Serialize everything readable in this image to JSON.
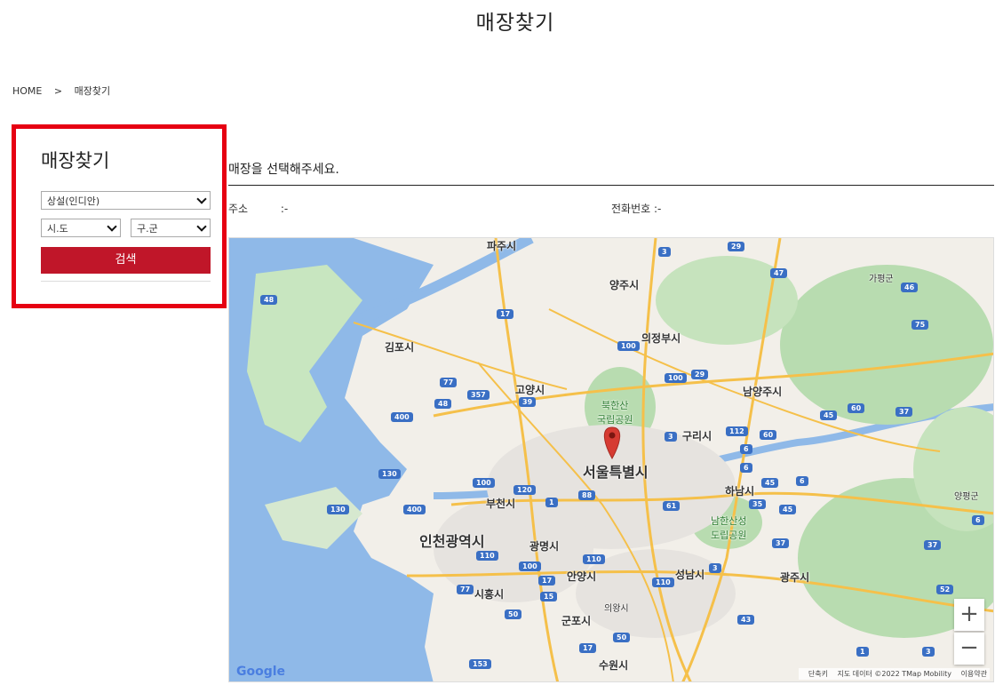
{
  "page": {
    "title": "매장찾기"
  },
  "breadcrumb": {
    "home": "HOME",
    "sep": ">",
    "current": "매장찾기"
  },
  "search": {
    "title": "매장찾기",
    "brand_select": "상설(인디안)",
    "sido_select": "시.도",
    "gugun_select": "구.군",
    "button": "검색"
  },
  "info": {
    "heading": "매장을 선택해주세요.",
    "address_label": "주소",
    "address_value": ":-",
    "phone_label": "전화번호",
    "phone_value": ":-"
  },
  "map": {
    "cities": [
      {
        "name": "파주시"
      },
      {
        "name": "양주시"
      },
      {
        "name": "의정부시"
      },
      {
        "name": "김포시"
      },
      {
        "name": "고양시"
      },
      {
        "name": "남양주시"
      },
      {
        "name": "구리시"
      },
      {
        "name": "서울특별시"
      },
      {
        "name": "하남시"
      },
      {
        "name": "부천시"
      },
      {
        "name": "인천광역시"
      },
      {
        "name": "광명시"
      },
      {
        "name": "안양시"
      },
      {
        "name": "시흥시"
      },
      {
        "name": "성남시"
      },
      {
        "name": "광주시"
      },
      {
        "name": "군포시"
      },
      {
        "name": "의왕시"
      },
      {
        "name": "수원시"
      },
      {
        "name": "가평군"
      },
      {
        "name": "양평군"
      },
      {
        "name": "북한산\n국립공원"
      },
      {
        "name": "남한산성\n도립공원"
      }
    ],
    "shields": [
      "29",
      "47",
      "46",
      "17",
      "3",
      "100",
      "75",
      "48",
      "77",
      "357",
      "39",
      "100",
      "29",
      "60",
      "37",
      "400",
      "48",
      "6",
      "3",
      "112",
      "60",
      "45",
      "130",
      "100",
      "120",
      "1",
      "88",
      "61",
      "6",
      "35",
      "45",
      "45",
      "6",
      "130",
      "400",
      "110",
      "37",
      "100",
      "17",
      "15",
      "110",
      "3",
      "37",
      "52",
      "110",
      "77",
      "50",
      "17",
      "43",
      "50",
      "3",
      "153",
      "1",
      "6"
    ],
    "zoom_in": "+",
    "zoom_out": "−",
    "google": "Google",
    "attribution": [
      "단축키",
      "지도 데이터 ©2022 TMap Mobility",
      "이용약관"
    ],
    "water_color": "#8fb9e8",
    "land_color": "#f2efe9",
    "park_color": "#b8dcb0",
    "road_color": "#f5c04a"
  }
}
